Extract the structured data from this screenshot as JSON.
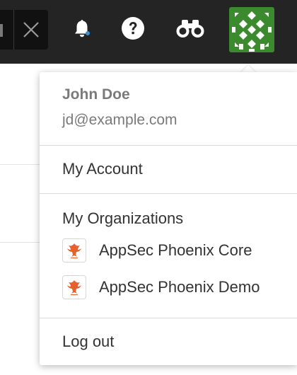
{
  "header": {
    "icons": [
      "close-icon",
      "bell-icon",
      "help-icon",
      "binoculars-icon",
      "avatar-icon"
    ],
    "accent_color": "#3b8a2e"
  },
  "user_menu": {
    "name": "John Doe",
    "email": "jd@example.com",
    "my_account_label": "My Account",
    "organizations_heading": "My Organizations",
    "organizations": [
      {
        "name": "AppSec Phoenix Core",
        "icon": "phoenix-logo-icon"
      },
      {
        "name": "AppSec Phoenix Demo",
        "icon": "phoenix-logo-icon"
      }
    ],
    "logout_label": "Log out"
  },
  "colors": {
    "topbar": "#242424",
    "avatar_green": "#3b8a2e",
    "notification_dot": "#3b8fd6",
    "phoenix_orange": "#e8612c"
  }
}
